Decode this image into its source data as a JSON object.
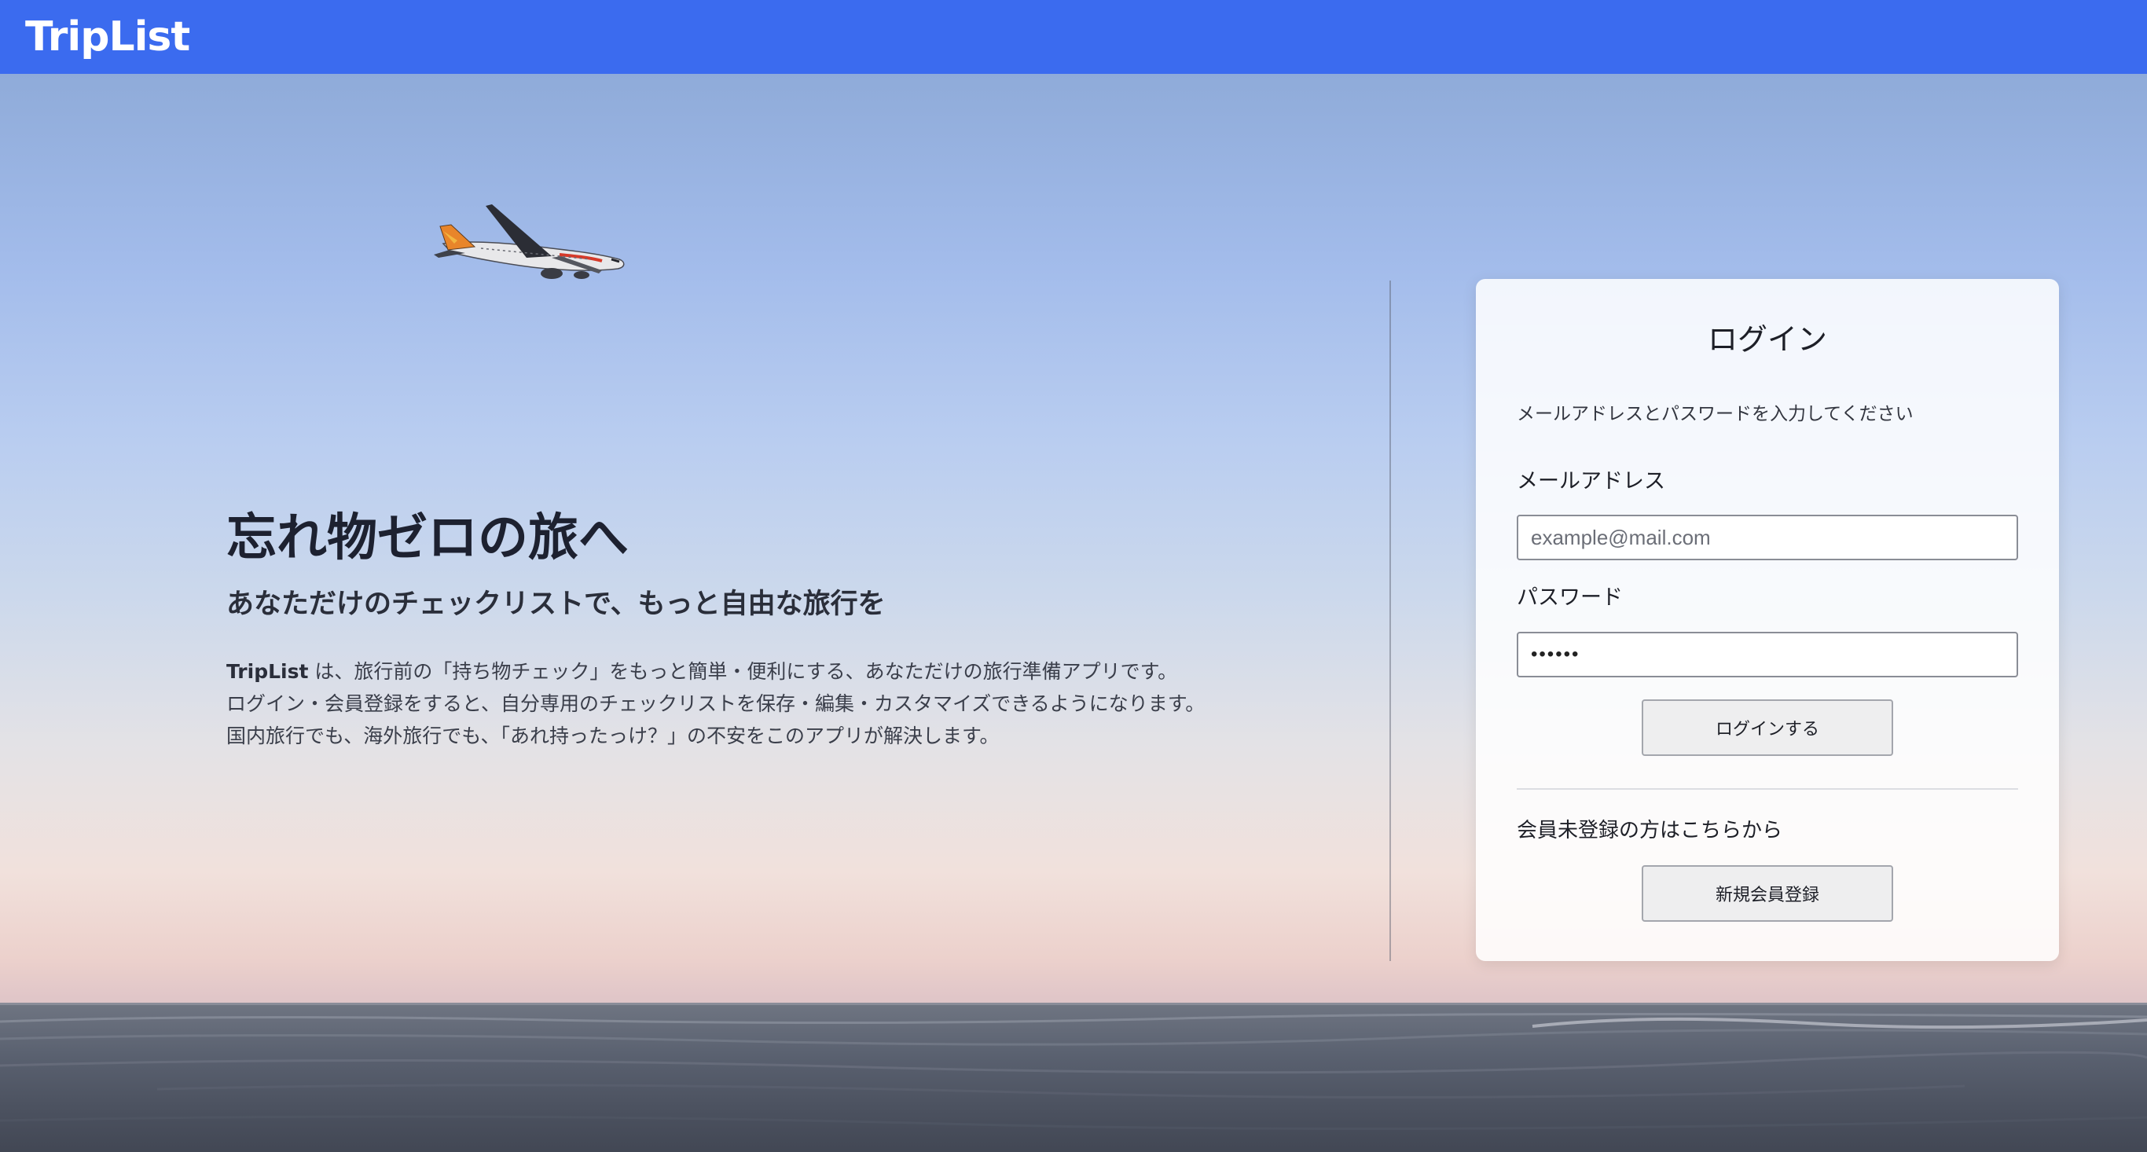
{
  "header": {
    "brand": "TripList",
    "brand_color": "#3b6bef"
  },
  "hero": {
    "title": "忘れ物ゼロの旅へ",
    "subtitle": "あなただけのチェックリストで、もっと自由な旅行を",
    "desc_brand": "TripList",
    "desc_line1_rest": " は、旅行前の「持ち物チェック」をもっと簡単・便利にする、あなただけの旅行準備アプリです。",
    "desc_line2": "ログイン・会員登録をすると、自分専用のチェックリストを保存・編集・カスタマイズできるようになります。",
    "desc_line3": "国内旅行でも、海外旅行でも、「あれ持ったっけ？」の不安をこのアプリが解決します。"
  },
  "login": {
    "title": "ログイン",
    "help": "メールアドレスとパスワードを入力してください",
    "email_label": "メールアドレス",
    "email_placeholder": "example@mail.com",
    "email_value": "",
    "password_label": "パスワード",
    "password_value": "••••••",
    "submit_label": "ログインする",
    "register_note": "会員未登録の方はこちらから",
    "register_label": "新規会員登録"
  },
  "icons": {
    "airplane": "airplane-photo",
    "sea": "sea-photo"
  }
}
